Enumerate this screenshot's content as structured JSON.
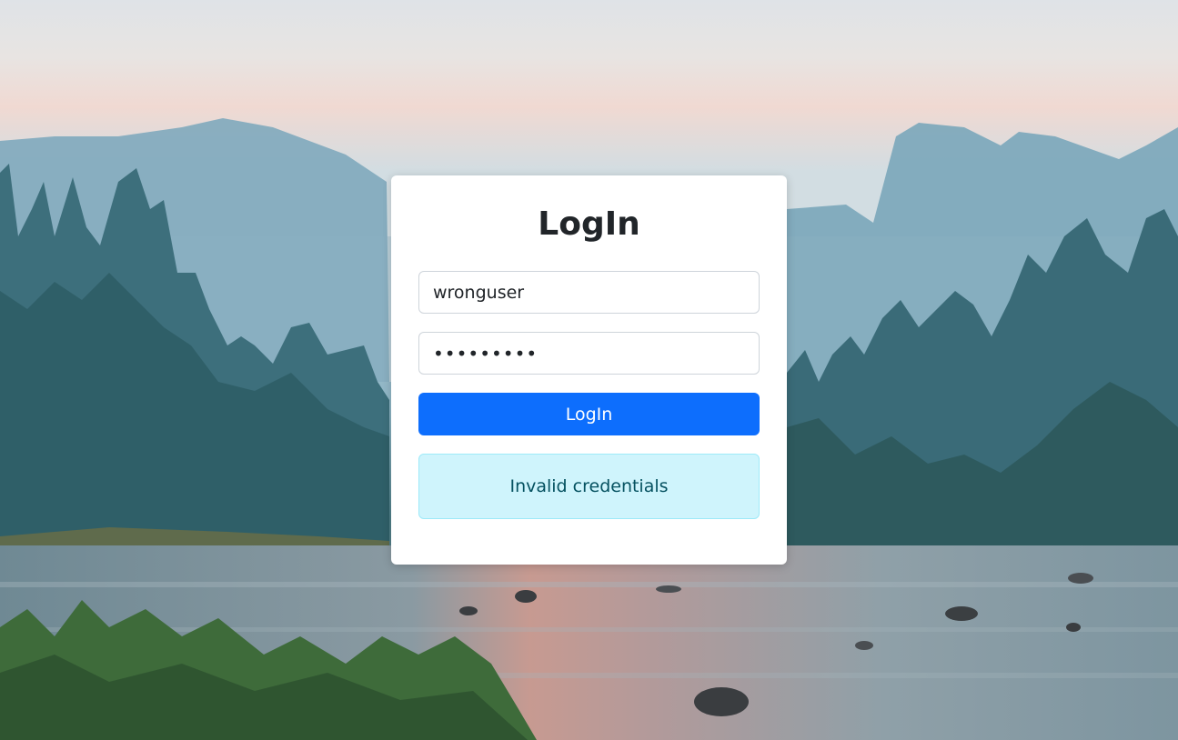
{
  "background": {
    "description_icon": "landscape-photo"
  },
  "login": {
    "title": "LogIn",
    "username_value": "wronguser",
    "password_value": "wrongpass",
    "submit_label": "LogIn",
    "alert_text": "Invalid credentials"
  },
  "colors": {
    "primary": "#0d6efd",
    "alert_bg": "#cff4fc",
    "alert_border": "#9eeaf9",
    "alert_text": "#055160"
  }
}
